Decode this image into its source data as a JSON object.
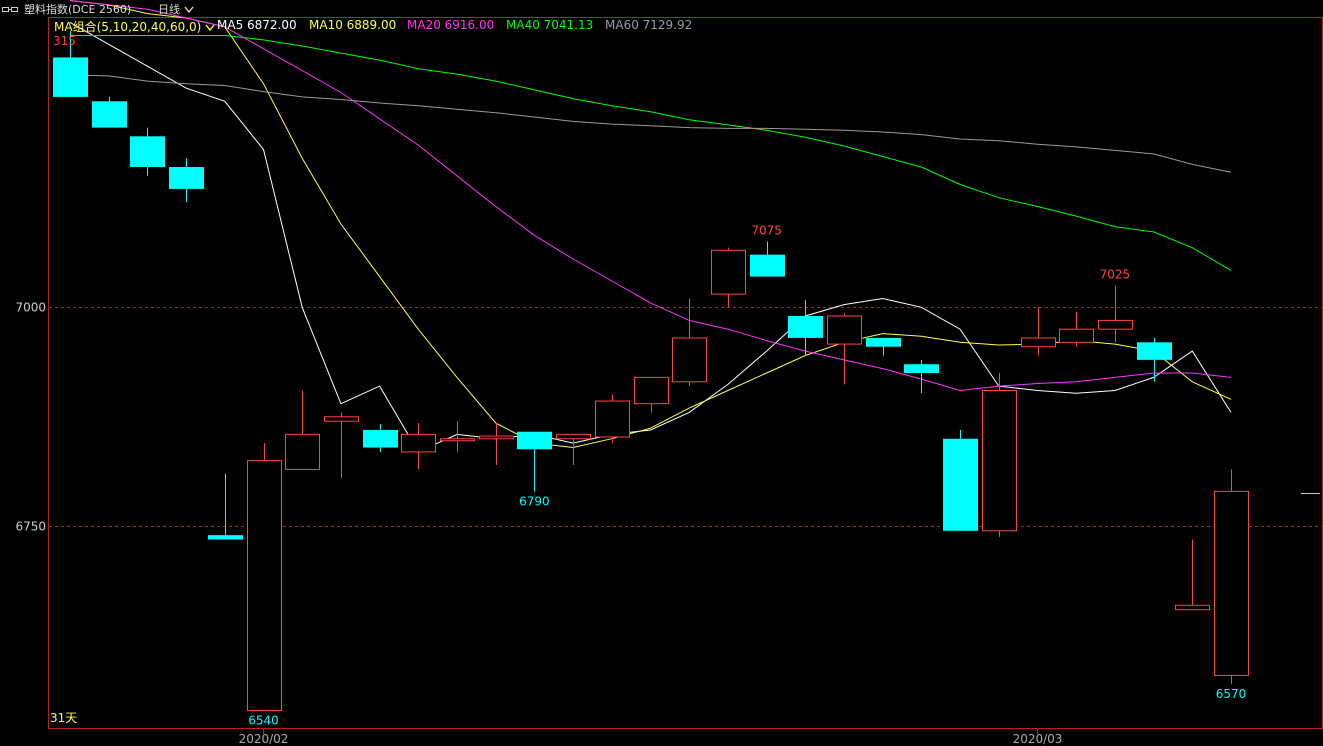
{
  "header": {
    "menu_icon": "window-menu-icon",
    "title": "塑料指数(DCE 2560)",
    "period": "日线",
    "period_icon": "chevron-down-icon"
  },
  "legend": {
    "ma_group": "MA组合(5,10,20,40,60,0)",
    "ma_group_icon": "chevron-down-icon",
    "ma5": "MA5 6872.00",
    "ma10": "MA10 6889.00",
    "ma20": "MA20 6916.00",
    "ma40": "MA40 7041.13",
    "ma60": "MA60 7129.92"
  },
  "colors": {
    "up": "#ff4444",
    "down": "#00ffff",
    "ma5": "#ffffff",
    "ma10": "#ffff44",
    "ma20": "#ff33ff",
    "ma40": "#00ff00",
    "ma60": "#999999",
    "border": "#b22222"
  },
  "corner_labels": {
    "top_left": "315",
    "bottom_left": "31天"
  },
  "chart_data": {
    "type": "candlestick",
    "ylim": [
      6520,
      7330
    ],
    "yticks": [
      {
        "value": 7000,
        "label": "7000"
      },
      {
        "value": 6750,
        "label": "6750"
      }
    ],
    "xticks": [
      {
        "index": 5,
        "label": "2020/02"
      },
      {
        "index": 25,
        "label": "2020/03"
      }
    ],
    "candles": [
      {
        "o": 7285,
        "h": 7315,
        "l": 7245,
        "c": 7240
      },
      {
        "o": 7235,
        "h": 7240,
        "l": 7210,
        "c": 7205
      },
      {
        "o": 7195,
        "h": 7205,
        "l": 7150,
        "c": 7160
      },
      {
        "o": 7160,
        "h": 7170,
        "l": 7120,
        "c": 7135
      },
      {
        "o": 6740,
        "h": 6810,
        "l": 6735,
        "c": 6735
      },
      {
        "o": 6540,
        "h": 6845,
        "l": 6540,
        "c": 6825
      },
      {
        "o": 6815,
        "h": 6905,
        "l": 6815,
        "c": 6855
      },
      {
        "o": 6870,
        "h": 6880,
        "l": 6805,
        "c": 6875
      },
      {
        "o": 6860,
        "h": 6867,
        "l": 6835,
        "c": 6840
      },
      {
        "o": 6835,
        "h": 6868,
        "l": 6815,
        "c": 6855
      },
      {
        "o": 6850,
        "h": 6870,
        "l": 6835,
        "c": 6850
      },
      {
        "o": 6850,
        "h": 6868,
        "l": 6820,
        "c": 6853
      },
      {
        "o": 6858,
        "h": 6858,
        "l": 6790,
        "c": 6838
      },
      {
        "o": 6850,
        "h": 6855,
        "l": 6820,
        "c": 6855
      },
      {
        "o": 6852,
        "h": 6900,
        "l": 6845,
        "c": 6893
      },
      {
        "o": 6890,
        "h": 6910,
        "l": 6880,
        "c": 6920
      },
      {
        "o": 6915,
        "h": 7010,
        "l": 6910,
        "c": 6965
      },
      {
        "o": 7015,
        "h": 7068,
        "l": 7000,
        "c": 7065
      },
      {
        "o": 7060,
        "h": 7075,
        "l": 7035,
        "c": 7035
      },
      {
        "o": 6990,
        "h": 7008,
        "l": 6945,
        "c": 6965
      },
      {
        "o": 6958,
        "h": 6993,
        "l": 6912,
        "c": 6990
      },
      {
        "o": 6965,
        "h": 6965,
        "l": 6945,
        "c": 6955
      },
      {
        "o": 6935,
        "h": 6940,
        "l": 6902,
        "c": 6925
      },
      {
        "o": 6850,
        "h": 6860,
        "l": 6745,
        "c": 6745
      },
      {
        "o": 6745,
        "h": 6925,
        "l": 6738,
        "c": 6905
      },
      {
        "o": 6955,
        "h": 7000,
        "l": 6945,
        "c": 6965
      },
      {
        "o": 6960,
        "h": 6995,
        "l": 6955,
        "c": 6975
      },
      {
        "o": 6975,
        "h": 7025,
        "l": 6960,
        "c": 6985
      },
      {
        "o": 6960,
        "h": 6965,
        "l": 6915,
        "c": 6940
      },
      {
        "o": 6655,
        "h": 6735,
        "l": 6655,
        "c": 6660
      },
      {
        "o": 6580,
        "h": 6815,
        "l": 6570,
        "c": 6790
      }
    ],
    "ma_lines": [
      {
        "name": "MA5",
        "values": [
          7325,
          7300,
          7275,
          7250,
          7235,
          7180,
          7000,
          6890,
          6910,
          6835,
          6855,
          6850,
          6855,
          6845,
          6855,
          6860,
          6880,
          6912,
          6950,
          6990,
          7003,
          7010,
          7000,
          6975,
          6910,
          6905,
          6902,
          6905,
          6920,
          6950,
          6880
        ]
      },
      {
        "name": "MA10",
        "values": [
          7350,
          7345,
          7335,
          7330,
          7320,
          7255,
          7170,
          7095,
          7035,
          6975,
          6920,
          6868,
          6845,
          6840,
          6850,
          6862,
          6885,
          6905,
          6925,
          6945,
          6960,
          6970,
          6967,
          6960,
          6957,
          6958,
          6962,
          6958,
          6950,
          6915,
          6895
        ]
      },
      {
        "name": "MA20",
        "values": [
          7350,
          7345,
          7340,
          7330,
          7320,
          7295,
          7270,
          7245,
          7215,
          7185,
          7150,
          7115,
          7082,
          7055,
          7030,
          7005,
          6985,
          6975,
          6962,
          6950,
          6940,
          6930,
          6918,
          6905,
          6910,
          6913,
          6915,
          6920,
          6925,
          6925,
          6920
        ]
      },
      {
        "name": "MA40",
        "values": [
          7310,
          7310,
          7310,
          7310,
          7310,
          7305,
          7298,
          7290,
          7282,
          7272,
          7266,
          7258,
          7248,
          7238,
          7230,
          7223,
          7214,
          7208,
          7202,
          7194,
          7184,
          7172,
          7160,
          7140,
          7125,
          7115,
          7104,
          7092,
          7086,
          7068,
          7042
        ]
      },
      {
        "name": "MA60",
        "values": [
          7265,
          7264,
          7258,
          7255,
          7253,
          7246,
          7240,
          7237,
          7233,
          7230,
          7226,
          7222,
          7217,
          7212,
          7209,
          7207,
          7205,
          7204,
          7204,
          7203,
          7202,
          7200,
          7197,
          7192,
          7190,
          7186,
          7183,
          7179,
          7175,
          7163,
          7154
        ]
      }
    ],
    "annotations": [
      {
        "index": 18,
        "value": 7075,
        "label": "7075",
        "pos": "above",
        "kind": "up"
      },
      {
        "index": 27,
        "value": 7025,
        "label": "7025",
        "pos": "above",
        "kind": "up"
      },
      {
        "index": 12,
        "value": 6790,
        "label": "6790",
        "pos": "below",
        "kind": "down"
      },
      {
        "index": 5,
        "value": 6540,
        "label": "6540",
        "pos": "below",
        "kind": "down"
      },
      {
        "index": 30,
        "value": 6570,
        "label": "6570",
        "pos": "below",
        "kind": "down"
      }
    ]
  }
}
